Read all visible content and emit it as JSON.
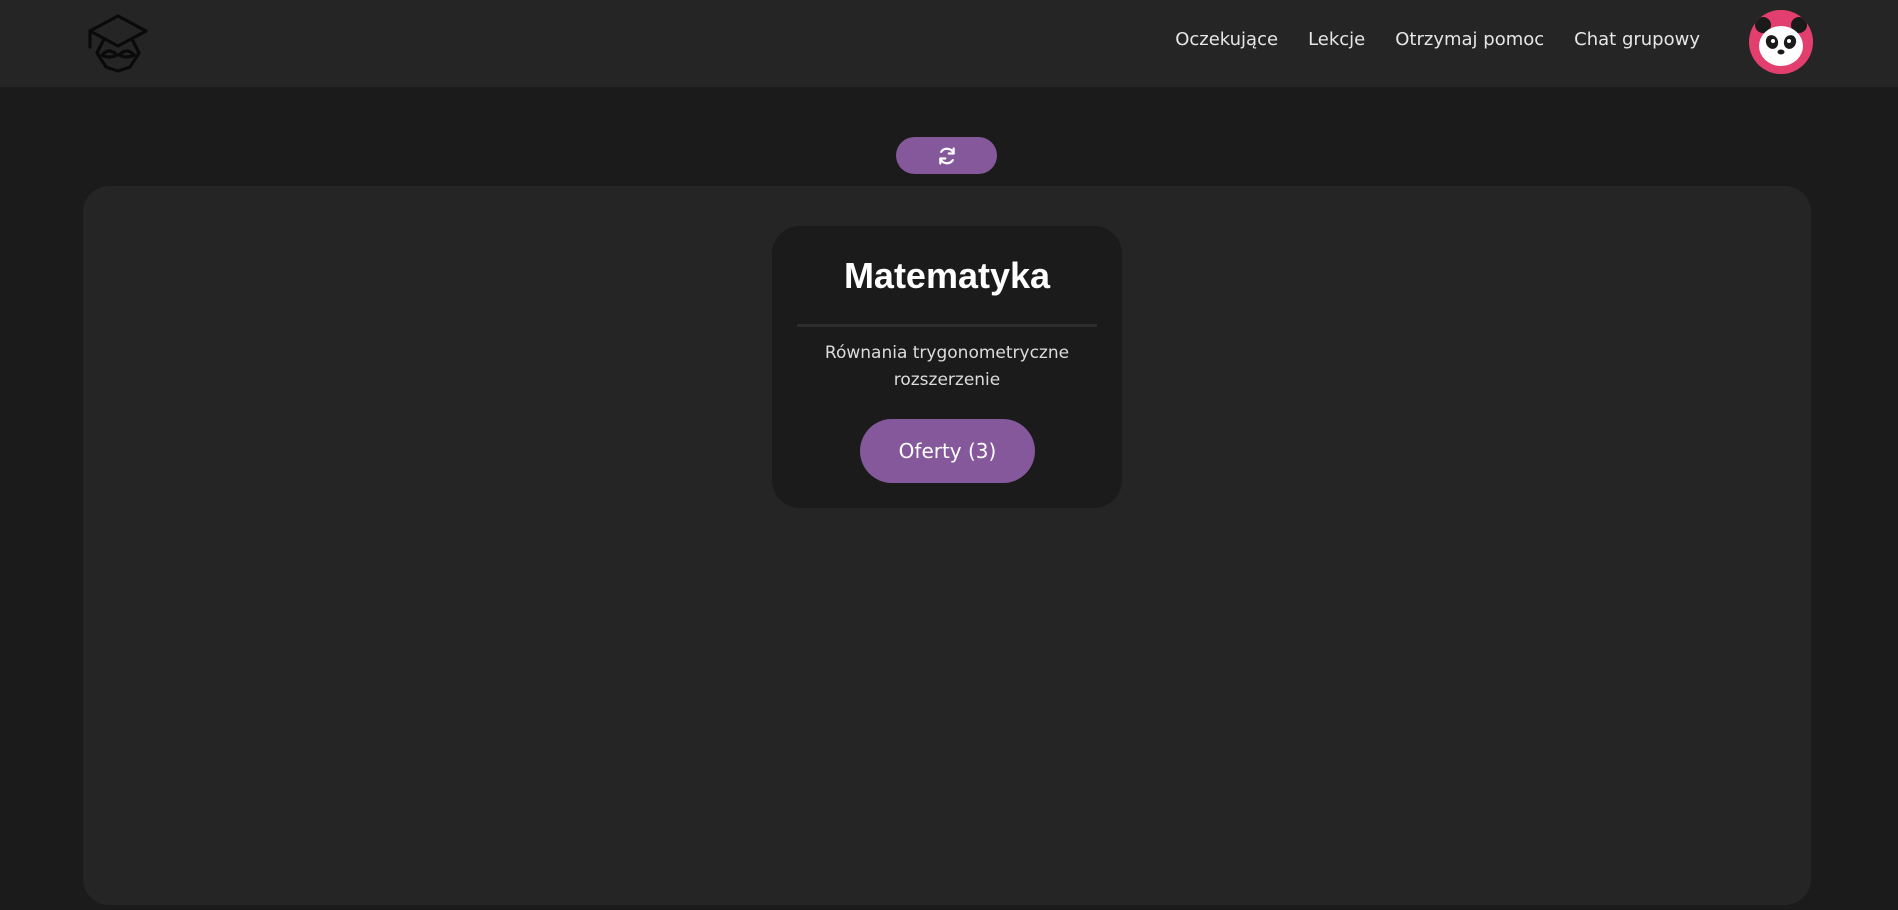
{
  "nav": {
    "logo_icon": "graduation-cap-book-icon",
    "links": [
      {
        "label": "Oczekujące"
      },
      {
        "label": "Lekcje"
      },
      {
        "label": "Otrzymaj pomoc"
      },
      {
        "label": "Chat grupowy"
      }
    ],
    "avatar_icon": "panda-avatar-icon"
  },
  "toolbar": {
    "refresh_icon": "refresh-icon"
  },
  "requests": [
    {
      "subject": "Matematyka",
      "topic": "Równania trygonometryczne rozszerzenie",
      "offers_label": "Oferty (3)"
    }
  ],
  "colors": {
    "background": "#1b1b1b",
    "navbar": "#252525",
    "panel": "#252525",
    "card": "#1b1b1b",
    "accent": "#84589a",
    "avatar": "#e23e6e"
  }
}
